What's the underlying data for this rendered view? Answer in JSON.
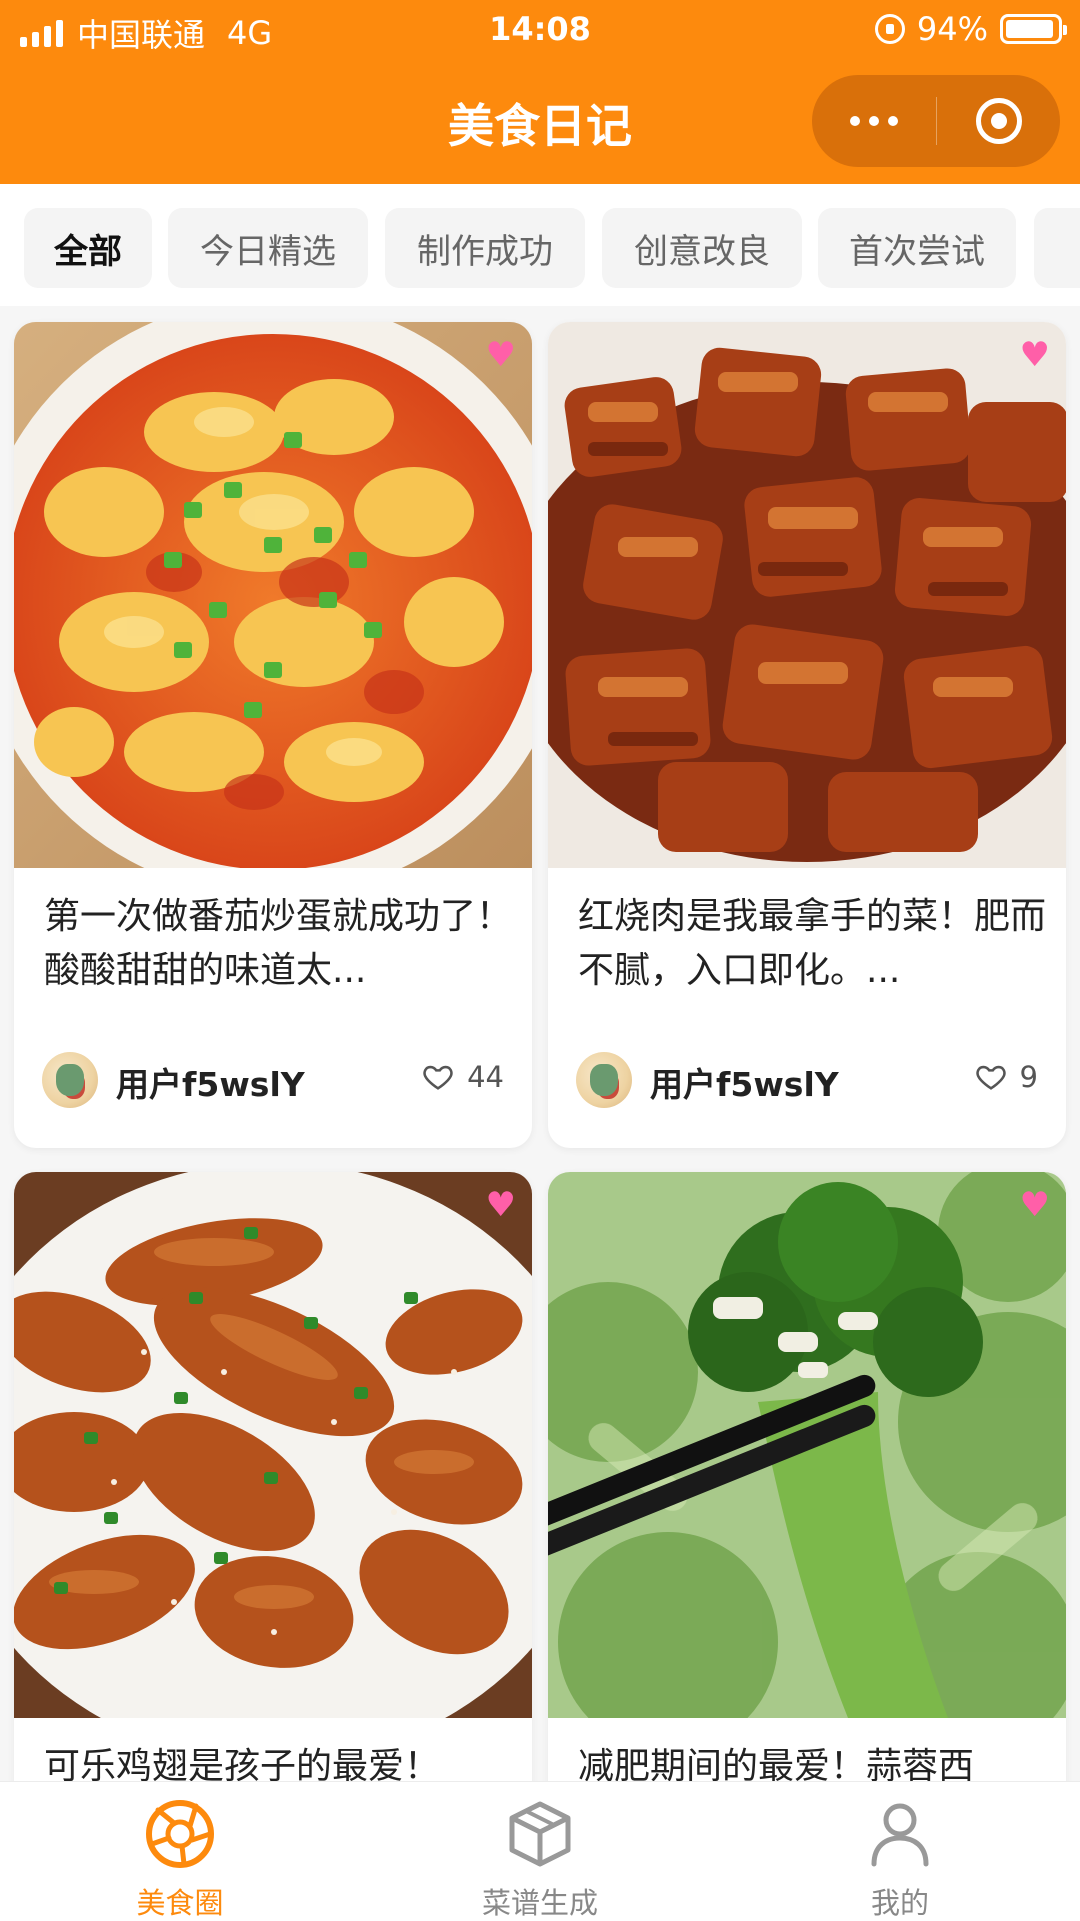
{
  "status_bar": {
    "carrier": "中国联通",
    "network": "4G",
    "time": "14:08",
    "battery": "94%",
    "battery_level": 0.94
  },
  "header": {
    "title": "美食日记",
    "more_icon": "more-dots-icon",
    "close_icon": "target-circle-icon"
  },
  "tabs": [
    {
      "label": "全部",
      "active": true
    },
    {
      "label": "今日精选"
    },
    {
      "label": "制作成功"
    },
    {
      "label": "创意改良"
    },
    {
      "label": "首次尝试"
    }
  ],
  "posts": [
    {
      "title": "第一次做番茄炒蛋就成功了！酸酸甜甜的味道太...",
      "user": "用户f5wslY",
      "likes": "44"
    },
    {
      "title": "红烧肉是我最拿手的菜！肥而不腻，入口即化。...",
      "user": "用户f5wslY",
      "likes": "9"
    },
    {
      "title": "可乐鸡翅是孩子的最爱！",
      "user": "",
      "likes": ""
    },
    {
      "title": "减肥期间的最爱！蒜蓉西",
      "user": "",
      "likes": ""
    }
  ],
  "bottom_nav": [
    {
      "label": "美食圈",
      "icon": "camera-aperture-icon",
      "active": true
    },
    {
      "label": "菜谱生成",
      "icon": "cube-icon"
    },
    {
      "label": "我的",
      "icon": "person-icon"
    }
  ],
  "colors": {
    "brand": "#fd8a0d",
    "capsule": "#d9700a",
    "background": "#f6f6f6"
  }
}
